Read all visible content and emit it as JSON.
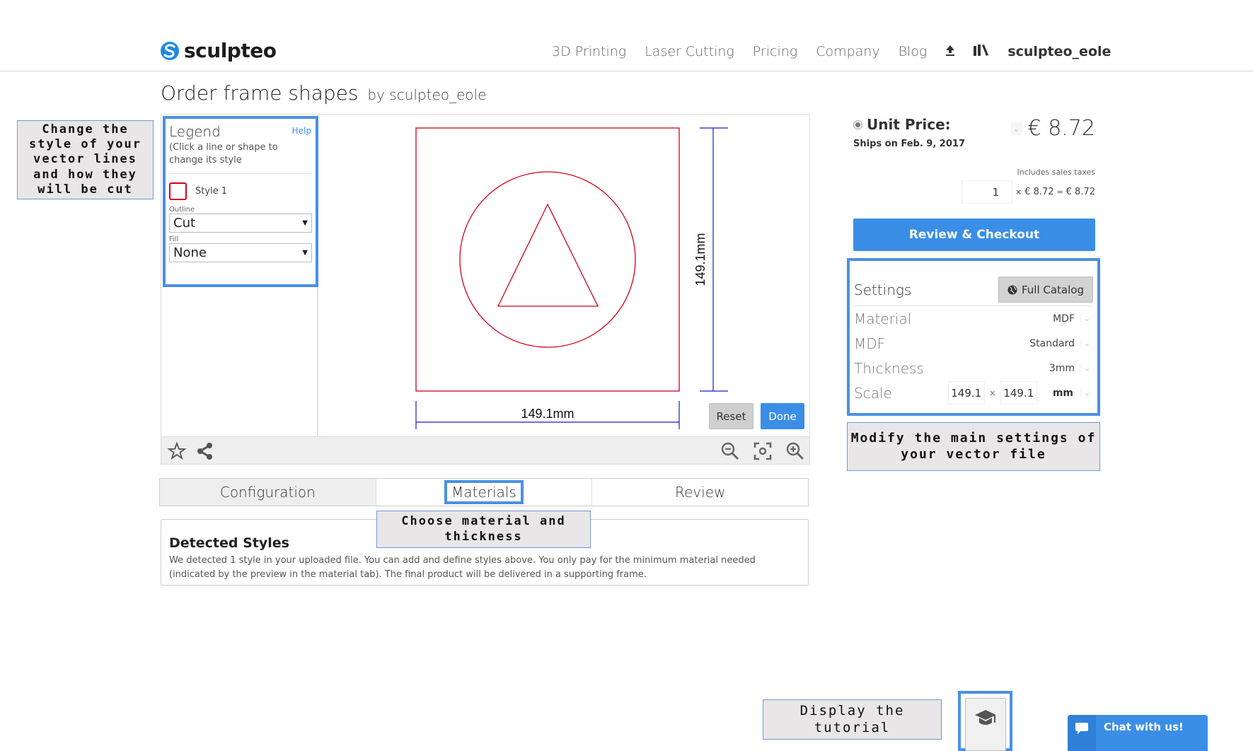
{
  "header": {
    "logo_text": "sculpteo",
    "nav": [
      "3D Printing",
      "Laser Cutting",
      "Pricing",
      "Company",
      "Blog"
    ],
    "upload_icon": "upload-icon",
    "library_icon": "library-icon",
    "username": "sculpteo_eole"
  },
  "page": {
    "title": "Order frame shapes",
    "by_label": "by sculpteo_eole"
  },
  "tooltips": {
    "legend": "Change the style of your vector lines and how they will be cut",
    "settings": "Modify the main settings of your vector file",
    "materials": "Choose material and thickness",
    "tutorial": "Display the tutorial"
  },
  "legend": {
    "title": "Legend",
    "help": "Help",
    "description": "(Click a line or shape to change its style",
    "style_name": "Style 1",
    "style_color": "#d0021b",
    "outline_label": "Outline",
    "outline_value": "Cut",
    "fill_label": "Fill",
    "fill_value": "None"
  },
  "canvas": {
    "width_dim": "149.1mm",
    "height_dim": "149.1mm",
    "cut_color": "#d0021b",
    "dim_color": "#1a1acc",
    "reset_label": "Reset",
    "done_label": "Done"
  },
  "toolbar": {
    "left_icons": [
      "star-icon",
      "share-icon"
    ],
    "right_icons": [
      "zoom-out-icon",
      "fit-view-icon",
      "zoom-in-icon"
    ]
  },
  "tabs": [
    {
      "label": "Configuration",
      "active": false
    },
    {
      "label": "Materials",
      "active": true
    },
    {
      "label": "Review",
      "active": false
    }
  ],
  "detected": {
    "title": "Detected Styles",
    "text": "We detected 1 style in your uploaded file. You can add and define styles above. You only pay for the minimum material needed (indicated by the preview in the material tab). The final product will be delivered in a supporting frame."
  },
  "pricing": {
    "unit_label": "Unit Price:",
    "ships": "Ships on Feb. 9, 2017",
    "price": "€ 8.72",
    "tax_note": "Includes sales taxes",
    "quantity": "1",
    "times": "×",
    "unit": "€ 8.72",
    "equals": "=",
    "total": "€ 8.72",
    "checkout_label": "Review & Checkout"
  },
  "settings": {
    "title": "Settings",
    "catalog_label": "Full Catalog",
    "rows": [
      {
        "label": "Material",
        "value": "MDF"
      },
      {
        "label": "MDF",
        "value": "Standard"
      },
      {
        "label": "Thickness",
        "value": "3mm"
      }
    ],
    "scale_label": "Scale",
    "scale_x": "149.1",
    "scale_y": "149.1",
    "scale_sep": "×",
    "scale_unit": "mm"
  },
  "chat": {
    "label": "Chat with us!"
  },
  "colors": {
    "accent": "#3a8ee6",
    "highlight": "#4a90e2"
  }
}
